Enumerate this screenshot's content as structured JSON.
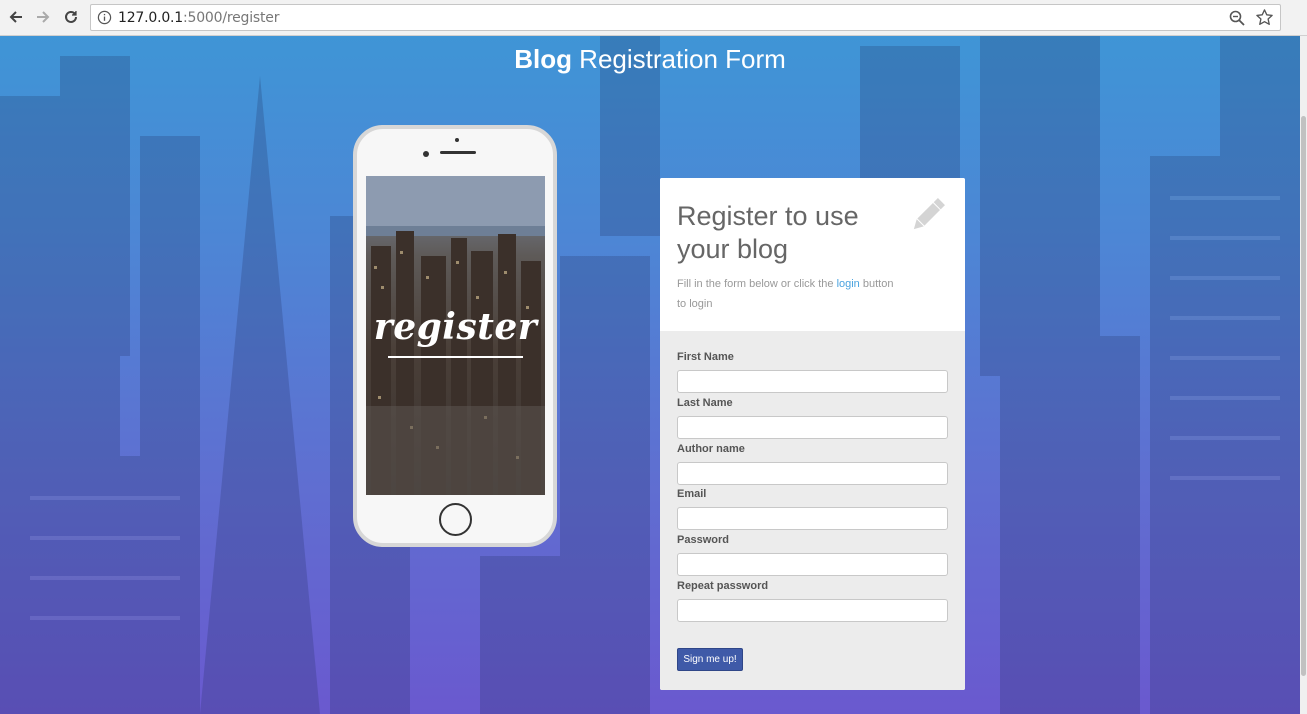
{
  "browser": {
    "url_host": "127.0.0.1",
    "url_path": ":5000/register"
  },
  "page": {
    "title_bold": "Blog",
    "title_rest": " Registration Form"
  },
  "phone": {
    "screen_text": "register"
  },
  "card": {
    "heading": "Register to use your blog",
    "sub_before": "Fill in the form below or click the ",
    "sub_link": "login",
    "sub_after": " button to login",
    "fields": [
      {
        "label": "First Name"
      },
      {
        "label": "Last Name"
      },
      {
        "label": "Author name"
      },
      {
        "label": "Email"
      },
      {
        "label": "Password"
      },
      {
        "label": "Repeat password"
      }
    ],
    "submit_label": "Sign me up!"
  },
  "icons": {
    "back": "back-arrow-icon",
    "forward": "forward-arrow-icon",
    "reload": "reload-icon",
    "info": "info-icon",
    "zoom": "zoom-icon",
    "star": "star-icon",
    "pencil": "pencil-icon"
  }
}
